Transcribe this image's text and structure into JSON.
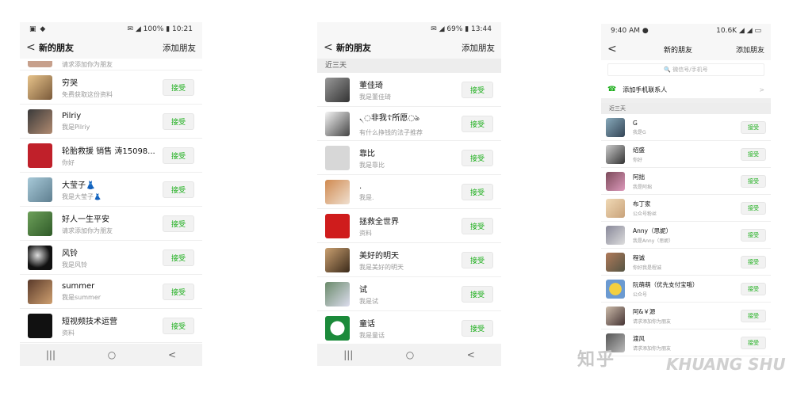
{
  "screens": [
    {
      "status": {
        "left": "▣ ◆",
        "right": "✉ ◢ 100% ▮ 10:21"
      },
      "header": {
        "back": "<",
        "title": "新的朋友",
        "add": "添加朋友"
      },
      "partial_text": "请求添加你为朋友",
      "rows": [
        {
          "name": "穷哭",
          "sub": "免费获取这份资料",
          "action": "接受"
        },
        {
          "name": "Pilriy",
          "sub": "我是Pilriy",
          "action": "接受"
        },
        {
          "name": "轮胎救援 销售 涛15098...",
          "sub": "你好",
          "action": "接受"
        },
        {
          "name": "大莹子👗",
          "sub": "我是大莹子👗",
          "action": "接受"
        },
        {
          "name": "好人一生平安",
          "sub": "请求添加你为朋友",
          "action": "接受"
        },
        {
          "name": "风铃",
          "sub": "我是风铃",
          "action": "接受"
        },
        {
          "name": "summer",
          "sub": "我是summer",
          "action": "接受"
        },
        {
          "name": "短视频技术运营",
          "sub": "资料",
          "action": "接受"
        }
      ],
      "nav": [
        "|||",
        "○",
        "<"
      ]
    },
    {
      "status": {
        "left": "",
        "right": "✉ ◢ 69% ▮ 13:44"
      },
      "header": {
        "back": "<",
        "title": "新的朋友",
        "add": "添加朋友"
      },
      "section": "近三天",
      "rows": [
        {
          "name": "董佳琦",
          "sub": "我是董佳琦",
          "action": "接受"
        },
        {
          "name": "৲◌非我☦所愿◌ঌ",
          "sub": "有什么挣钱的法子推荐",
          "action": "接受"
        },
        {
          "name": "靠比",
          "sub": "我是靠比",
          "action": "接受"
        },
        {
          "name": ".",
          "sub": "我是.",
          "action": "接受"
        },
        {
          "name": "拯救全世界",
          "sub": "资料",
          "action": "接受"
        },
        {
          "name": "美好的明天",
          "sub": "我是美好的明天",
          "action": "接受"
        },
        {
          "name": "试",
          "sub": "我是试",
          "action": "接受"
        },
        {
          "name": "童话",
          "sub": "我是童话",
          "action": "接受"
        }
      ],
      "nav": [
        "|||",
        "○",
        "<"
      ]
    },
    {
      "status": {
        "left": "9:40 AM ●",
        "right": "10.6K ◢ ◢ ▭"
      },
      "header": {
        "back": "<",
        "title": "新的朋友",
        "add": "添加朋友"
      },
      "search_placeholder": "🔍 微信号/手机号",
      "add_contact": {
        "icon": "☎",
        "label": "添加手机联系人",
        "chev": ">"
      },
      "section": "近三天",
      "rows": [
        {
          "name": "G",
          "sub": "我是G",
          "action": "接受"
        },
        {
          "name": "绍盛",
          "sub": "你好",
          "action": "接受"
        },
        {
          "name": "阿拙",
          "sub": "我是阿拙",
          "action": "接受"
        },
        {
          "name": "布丁家",
          "sub": "公众号粉丝",
          "action": "接受"
        },
        {
          "name": "Anny（思妮）",
          "sub": "我是Anny（思妮）",
          "action": "接受"
        },
        {
          "name": "程诚",
          "sub": "你好我是程诚",
          "action": "接受"
        },
        {
          "name": "阮萌萌（优先支付宝哦）",
          "sub": "公众号",
          "action": "接受"
        },
        {
          "name": "阿&￥源",
          "sub": "请求添加你为朋友",
          "action": "接受"
        },
        {
          "name": "渡风",
          "sub": "请求添加你为朋友",
          "action": "接受"
        }
      ]
    }
  ],
  "watermark": {
    "zhihu": "知乎",
    "brand": "KHUANG SHU"
  }
}
